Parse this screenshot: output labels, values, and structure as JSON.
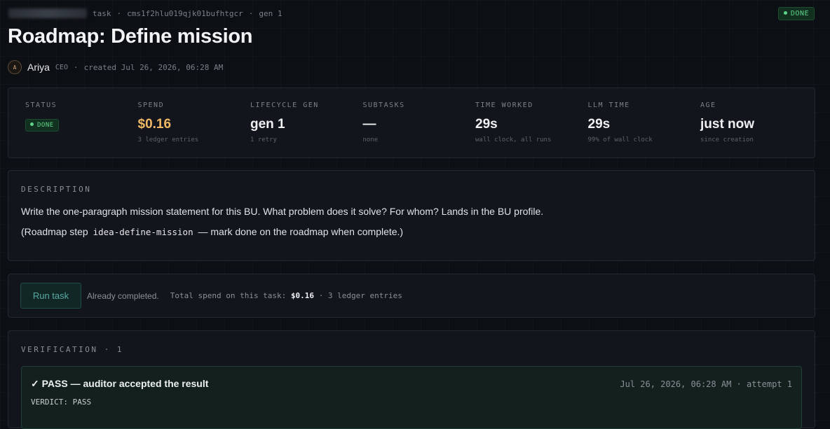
{
  "header": {
    "breadcrumb_task": "task",
    "task_id": "cms1f2hlu019qjk01bufhtgcr",
    "gen": "gen 1",
    "status_badge": "DONE",
    "title": "Roadmap: Define mission"
  },
  "byline": {
    "avatar_initial": "A",
    "author": "Ariya",
    "role": "CEO",
    "created": "created Jul 26, 2026, 06:28 AM"
  },
  "stats": [
    {
      "label": "STATUS",
      "badge": "DONE"
    },
    {
      "label": "SPEND",
      "value": "$0.16",
      "sub": "3 ledger entries"
    },
    {
      "label": "LIFECYCLE GEN",
      "value": "gen 1",
      "sub": "1 retry"
    },
    {
      "label": "SUBTASKS",
      "value": "—",
      "sub": "none"
    },
    {
      "label": "TIME WORKED",
      "value": "29s",
      "sub": "wall clock, all runs"
    },
    {
      "label": "LLM TIME",
      "value": "29s",
      "sub": "99% of wall clock"
    },
    {
      "label": "AGE",
      "value": "just now",
      "sub": "since creation"
    }
  ],
  "description": {
    "label": "DESCRIPTION",
    "text1": "Write the one-paragraph mission statement for this BU. What problem does it solve? For whom? Lands in the BU profile.",
    "text2_pre": "(Roadmap step",
    "text2_code": "idea-define-mission",
    "text2_post": "— mark done on the roadmap when complete.)"
  },
  "run": {
    "button_label": "Run task",
    "status": "Already completed.",
    "spend_prefix": "Total spend on this task:",
    "spend_value": "$0.16",
    "spend_suffix": "· 3 ledger entries"
  },
  "verification": {
    "label": "VERIFICATION · 1",
    "result_title": "✓ PASS — auditor accepted the result",
    "result_meta": "Jul 26, 2026, 06:28 AM · attempt 1",
    "verdict": "VERDICT: PASS"
  },
  "colors": {
    "background": "#0c0f13",
    "accent_green": "#5ed58a",
    "spend_orange": "#f0b866",
    "teal_button": "#5aa9a2"
  }
}
